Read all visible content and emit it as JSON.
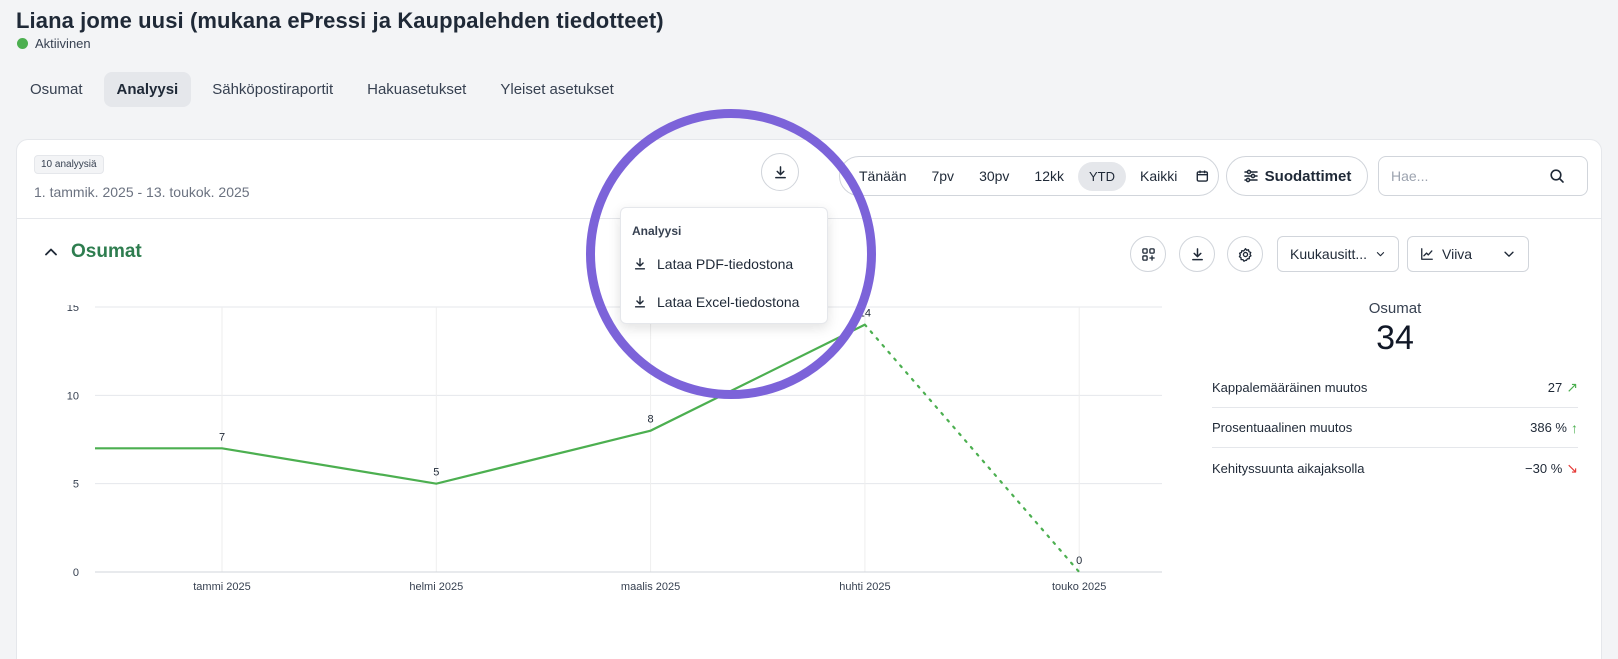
{
  "header": {
    "title": "Liana jome uusi (mukana ePressi ja Kauppalehden tiedotteet)",
    "status": "Aktiivinen",
    "status_color": "#4caf50"
  },
  "tabs": [
    {
      "label": "Osumat",
      "active": false
    },
    {
      "label": "Analyysi",
      "active": true
    },
    {
      "label": "Sähköpostiraportit",
      "active": false
    },
    {
      "label": "Hakuasetukset",
      "active": false
    },
    {
      "label": "Yleiset asetukset",
      "active": false
    }
  ],
  "toolbar": {
    "count_badge": "10 analyysiä",
    "date_range": "1. tammik. 2025 - 13. toukok. 2025",
    "ranges": [
      "Tänään",
      "7pv",
      "30pv",
      "12kk",
      "YTD",
      "Kaikki"
    ],
    "active_range": "YTD",
    "filters_label": "Suodattimet",
    "search_placeholder": "Hae..."
  },
  "dropdown": {
    "title": "Analyysi",
    "items": [
      "Lataa PDF-tiedostona",
      "Lataa Excel-tiedostona"
    ]
  },
  "section": {
    "title": "Osumat",
    "period_select": "Kuukausitt...",
    "chart_type_select": "Viiva"
  },
  "chart_data": {
    "type": "line",
    "categories": [
      "tammi 2025",
      "helmi 2025",
      "maalis 2025",
      "huhti 2025",
      "touko 2025"
    ],
    "values": [
      7,
      5,
      8,
      14,
      0
    ],
    "y_ticks": [
      0,
      5,
      10,
      15
    ],
    "ylim": [
      0,
      15
    ],
    "line_color": "#4caf50",
    "last_segment_style": "dotted",
    "grid": true
  },
  "stats": {
    "title": "Osumat",
    "total": "34",
    "rows": [
      {
        "label": "Kappalemääräinen muutos",
        "value": "27",
        "arrow": "↗",
        "color": "#4caf50"
      },
      {
        "label": "Prosentuaalinen muutos",
        "value": "386 %",
        "arrow": "↑",
        "color": "#4caf50"
      },
      {
        "label": "Kehityssuunta aikajaksolla",
        "value": "−30 %",
        "arrow": "↘",
        "color": "#e53935"
      }
    ]
  },
  "highlight_color": "#7c63d9"
}
